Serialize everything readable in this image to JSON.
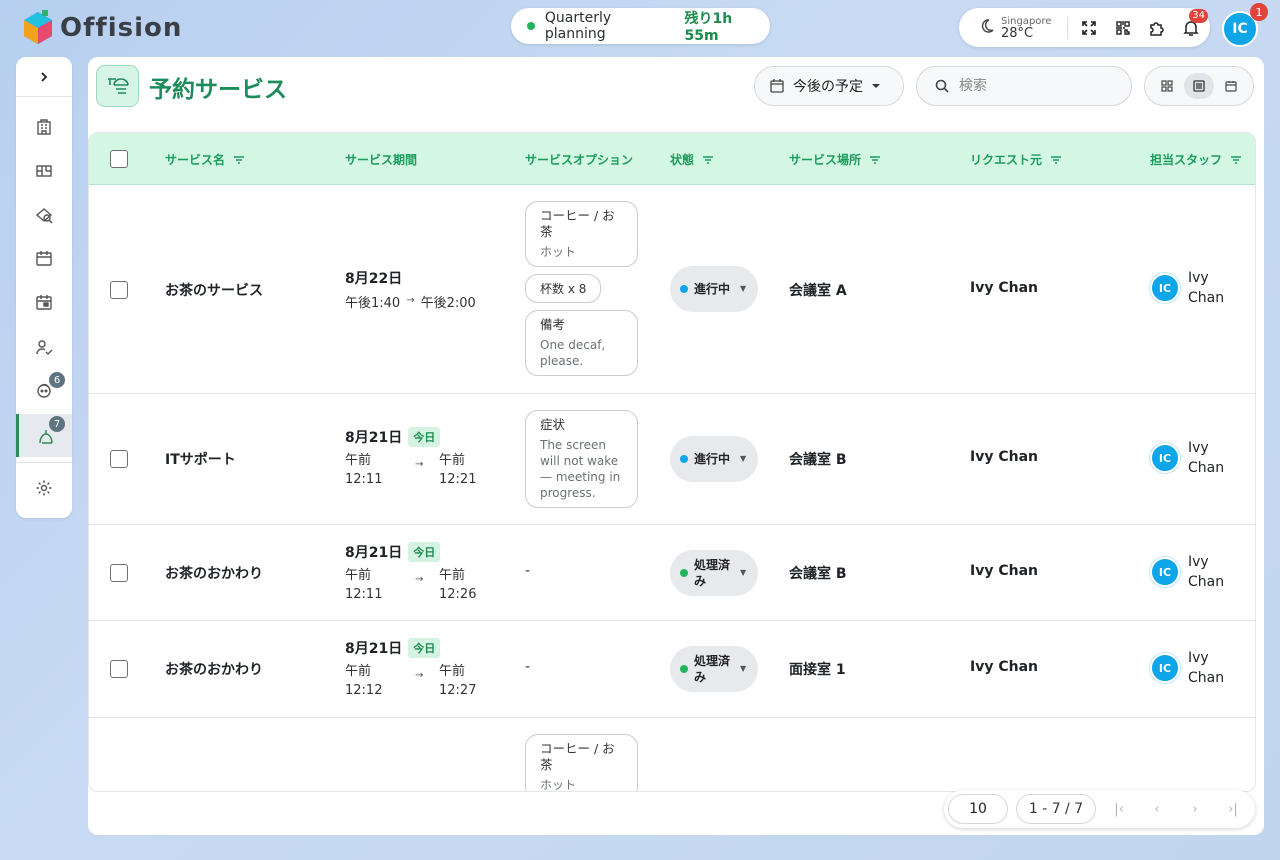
{
  "app": {
    "name": "Offision"
  },
  "timer": {
    "title": "Quarterly planning",
    "remaining": "残り1h 55m"
  },
  "topbar": {
    "weather": {
      "city": "Singapore",
      "temp": "28°C"
    },
    "notification_count": "34",
    "avatar_initials": "IC",
    "avatar_badge": "1"
  },
  "sidebar": {
    "badges": {
      "item7": "6",
      "item8": "7"
    }
  },
  "page": {
    "title": "予約サービス",
    "filter_label": "今後の予定",
    "search_placeholder": "検索"
  },
  "table": {
    "columns": [
      "サービス名",
      "サービス期間",
      "サービスオプション",
      "状態",
      "サービス場所",
      "リクエスト元",
      "担当スタッフ"
    ],
    "rows": [
      {
        "name": "お茶のサービス",
        "date": "8月22日",
        "today": "",
        "start": "午後1:40",
        "end": "午後2:00",
        "options": [
          {
            "kind": "card",
            "title": "コーヒー / お茶",
            "sub": "ホット"
          },
          {
            "kind": "chip",
            "title": "杯数 x 8"
          },
          {
            "kind": "card",
            "title": "備考",
            "sub": "One decaf, please."
          }
        ],
        "status": "進行中",
        "status_color": "#0ea5e9",
        "location": "会議室 A",
        "requester": "Ivy Chan",
        "staff_initials": "IC",
        "staff": "Ivy Chan"
      },
      {
        "name": "ITサポート",
        "date": "8月21日",
        "today": "今日",
        "start": "午前 12:11",
        "end": "午前 12:21",
        "options": [
          {
            "kind": "card",
            "title": "症状",
            "sub": "The screen will not wake — meeting in progress."
          }
        ],
        "status": "進行中",
        "status_color": "#0ea5e9",
        "location": "会議室 B",
        "requester": "Ivy Chan",
        "staff_initials": "IC",
        "staff": "Ivy Chan"
      },
      {
        "name": "お茶のおかわり",
        "date": "8月21日",
        "today": "今日",
        "start": "午前 12:11",
        "end": "午前 12:26",
        "options": [],
        "status": "処理済み",
        "status_color": "#22b35e",
        "location": "会議室 B",
        "requester": "Ivy Chan",
        "staff_initials": "IC",
        "staff": "Ivy Chan"
      },
      {
        "name": "お茶のおかわり",
        "date": "8月21日",
        "today": "今日",
        "start": "午前 12:12",
        "end": "午前 12:27",
        "options": [],
        "status": "処理済み",
        "status_color": "#22b35e",
        "location": "面接室 1",
        "requester": "Ivy Chan",
        "staff_initials": "IC",
        "staff": "Ivy Chan"
      },
      {
        "name": "",
        "date": "",
        "today": "",
        "start": "",
        "end": "",
        "options": [
          {
            "kind": "card",
            "title": "コーヒー / お茶",
            "sub": "ホット"
          }
        ],
        "status": "",
        "status_color": "",
        "location": "",
        "requester": "",
        "staff_initials": "",
        "staff": ""
      }
    ],
    "empty_option": "-"
  },
  "pagination": {
    "page_size": "10",
    "range": "1 - 7 / 7"
  },
  "colors": {
    "accent": "#1b8c5a",
    "header_bg": "#d4f7e4",
    "avatar": "#0ea5e9"
  }
}
